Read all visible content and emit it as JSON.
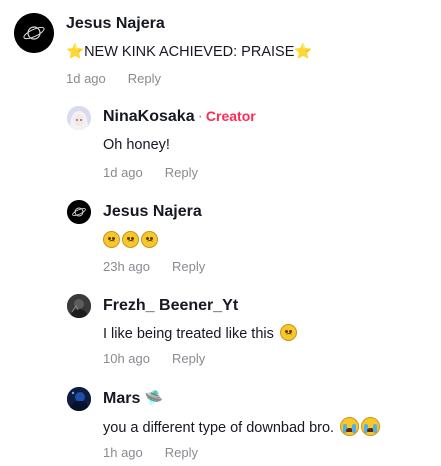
{
  "comments": [
    {
      "author": "Jesus Najera",
      "text": "NEW KINK ACHIEVED: PRAISE",
      "star_emoji": "⭐",
      "time": "1d ago",
      "reply": "Reply"
    },
    {
      "author": "NinaKosaka",
      "separator": "·",
      "badge": "Creator",
      "text": "Oh honey!",
      "time": "1d ago",
      "reply": "Reply"
    },
    {
      "author": "Jesus Najera",
      "text": "",
      "emoji_names": [
        "pleading-face",
        "pleading-face",
        "pleading-face"
      ],
      "time": "23h ago",
      "reply": "Reply"
    },
    {
      "author": "Frezh_ Beener_Yt",
      "text": "I like being treated like this",
      "time": "10h ago",
      "reply": "Reply"
    },
    {
      "author": "Mars",
      "author_emoji": "🛸",
      "text": "you a different type of downbad bro.",
      "emoji_names": [
        "loudly-crying-face",
        "loudly-crying-face"
      ],
      "time": "1h ago",
      "reply": "Reply"
    }
  ],
  "colors": {
    "creator": "#fe2c55",
    "meta": "#8a8b91",
    "text": "#161823"
  }
}
